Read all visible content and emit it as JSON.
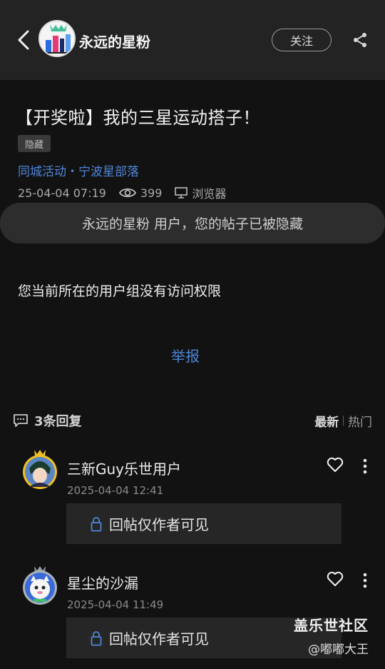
{
  "header": {
    "author_name": "永远的星粉",
    "follow_label": "关注"
  },
  "post": {
    "title": "【开奖啦】我的三星运动搭子！",
    "tag": "隐藏",
    "forum_path": "同城活动・宁波星部落",
    "date": "25-04-04 07:19",
    "views": "399",
    "client": "浏览器",
    "hidden_notice": "永远的星粉 用户，您的帖子已被隐藏",
    "no_access": "您当前所在的用户组没有访问权限",
    "report_label": "举报"
  },
  "replies_section": {
    "count_label": "3条回复",
    "sort_newest": "最新",
    "sort_hot": "热门"
  },
  "replies": [
    {
      "name": "三新Guy乐世用户",
      "time": "2025-04-04 12:41",
      "content": "回帖仅作者可见"
    },
    {
      "name": "星尘的沙漏",
      "time": "2025-04-04 11:49",
      "content": "回帖仅作者可见"
    }
  ],
  "watermark": {
    "site": "盖乐世社区",
    "user": "@嘟嘟大王"
  },
  "colors": {
    "accent_blue": "#4f86d9",
    "background": "#121212",
    "header": "#232323"
  }
}
